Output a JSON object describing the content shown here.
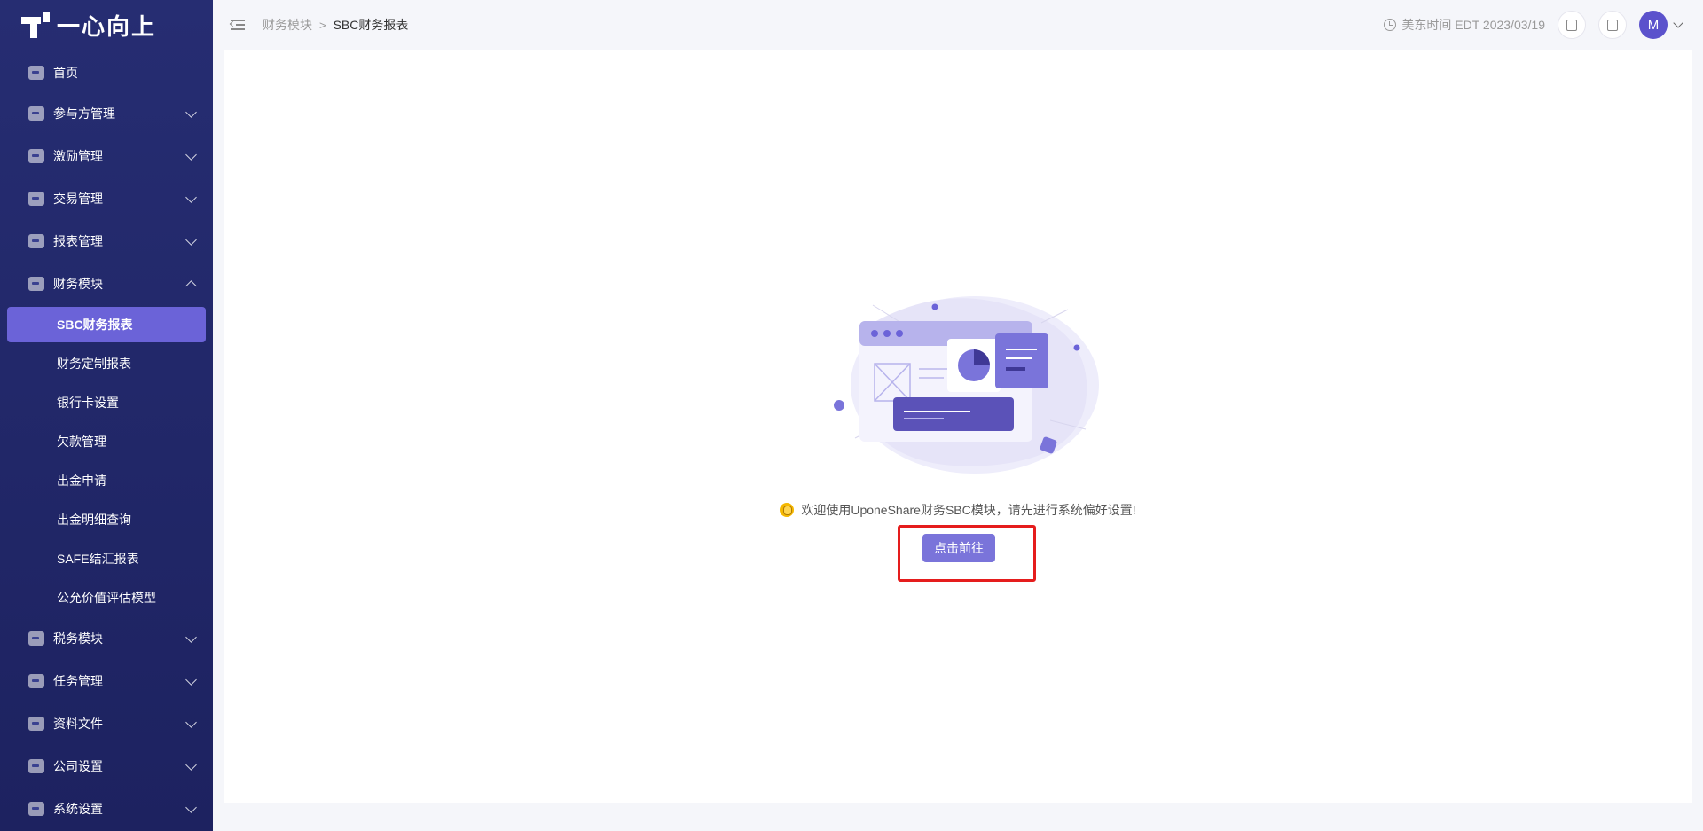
{
  "brand": {
    "name": "一心向上"
  },
  "sidebar": {
    "items": [
      {
        "label": "首页",
        "icon": "home-icon"
      },
      {
        "label": "参与方管理",
        "icon": "participants-icon"
      },
      {
        "label": "激励管理",
        "icon": "incentive-icon"
      },
      {
        "label": "交易管理",
        "icon": "transaction-icon"
      },
      {
        "label": "报表管理",
        "icon": "report-icon"
      },
      {
        "label": "财务模块",
        "icon": "finance-icon",
        "expanded": true,
        "children": [
          {
            "label": "SBC财务报表",
            "active": true
          },
          {
            "label": "财务定制报表"
          },
          {
            "label": "银行卡设置"
          },
          {
            "label": "欠款管理"
          },
          {
            "label": "出金申请"
          },
          {
            "label": "出金明细查询"
          },
          {
            "label": "SAFE结汇报表"
          },
          {
            "label": "公允价值评估模型"
          }
        ]
      },
      {
        "label": "税务模块",
        "icon": "tax-icon"
      },
      {
        "label": "任务管理",
        "icon": "task-icon"
      },
      {
        "label": "资料文件",
        "icon": "folder-icon"
      },
      {
        "label": "公司设置",
        "icon": "company-icon"
      },
      {
        "label": "系统设置",
        "icon": "settings-icon"
      }
    ]
  },
  "header": {
    "breadcrumb": [
      "财务模块",
      "SBC财务报表"
    ],
    "separator": ">",
    "timezone": "美东时间 EDT 2023/03/19",
    "avatar_initial": "M"
  },
  "main": {
    "welcome_text": "欢迎使用UponeShare财务SBC模块，请先进行系统偏好设置!",
    "goto_label": "点击前往"
  },
  "colors": {
    "sidebar_bg": "#262d72",
    "accent": "#6b63d8",
    "button": "#7a74da",
    "highlight_border": "#e51d1d"
  }
}
